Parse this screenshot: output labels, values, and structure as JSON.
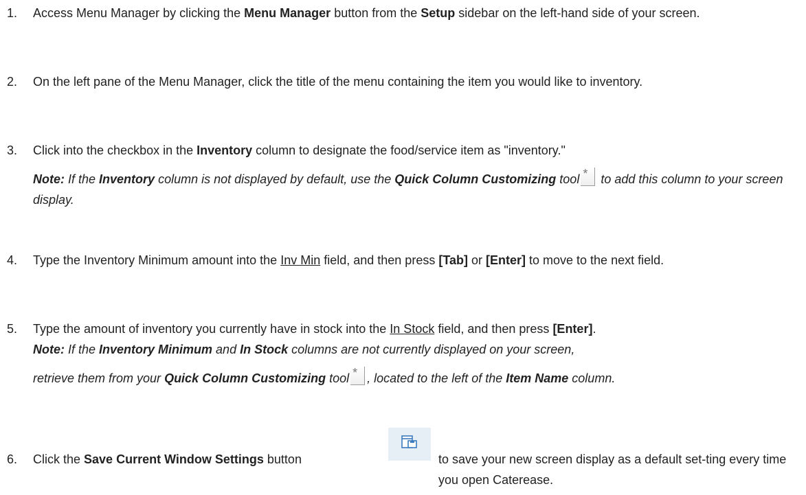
{
  "steps": [
    {
      "num": "1.",
      "t1": "Access Menu Manager by clicking the ",
      "b1": "Menu Manager",
      "t2": " button from the ",
      "b2": "Setup",
      "t3": " sidebar on the left-hand side of your screen."
    },
    {
      "num": "2.",
      "t1": "On the left pane of the Menu Manager, click the title of the menu containing the item you would like to inventory."
    },
    {
      "num": "3.",
      "t1": "Click into the checkbox in the ",
      "b1": "Inventory",
      "t2": " column to designate the food/service item as \"inventory.\"",
      "note": {
        "label": "Note:",
        "t1": " If the ",
        "b1": "Inventory",
        "t2": " column is not displayed by default, use the ",
        "b2": "Quick Column Customizing",
        "t3": " tool",
        "t4": " to add this column to your screen display."
      }
    },
    {
      "num": "4.",
      "t1": "Type the Inventory Minimum amount into the ",
      "u1": "Inv Min",
      "t2": " field, and then press ",
      "b1": "[Tab]",
      "t3": " or ",
      "b2": "[Enter]",
      "t4": " to move to the next field."
    },
    {
      "num": "5.",
      "t1": "Type the amount of inventory you currently have in stock into the ",
      "u1": "In Stock",
      "t2": " field, and then press ",
      "b1": "[Enter]",
      "t3": ".",
      "note": {
        "label": "Note:",
        "t1": " If the ",
        "b1": "Inventory Minimum",
        "t2": " and ",
        "b2": "In Stock",
        "t3": " columns are not currently displayed on your screen,",
        "t4": "retrieve them from your ",
        "b3": "Quick Column Customizing",
        "t5": " tool",
        "t6": ", located to the left of the ",
        "b4": "Item Name",
        "t7": " column."
      }
    },
    {
      "num": "6.",
      "t1": "Click the ",
      "b1": "Save Current Window Settings",
      "t2": " button",
      "t3": "to save your new screen display as a default set-ting every time you open Caterease."
    }
  ],
  "icons": {
    "quick_column": "quick-column-customizing-icon",
    "save_window": "save-window-settings-icon",
    "quick_column_glyph": "*"
  }
}
